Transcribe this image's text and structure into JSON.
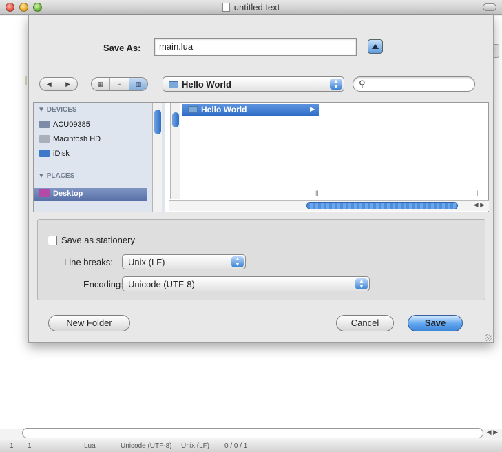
{
  "window": {
    "title": "untitled text"
  },
  "save_sheet": {
    "save_as_label": "Save As:",
    "filename": "main.lua",
    "view_modes": [
      "icon",
      "list",
      "column"
    ],
    "location": "Hello World",
    "search_placeholder": "",
    "sidebar": {
      "devices_header": "DEVICES",
      "devices": [
        "ACU09385",
        "Macintosh HD",
        "iDisk"
      ],
      "places_header": "PLACES",
      "selected_place": "Desktop"
    },
    "browser": {
      "column_items": [
        "Hello World"
      ]
    },
    "options": {
      "stationery_label": "Save as stationery",
      "stationery_checked": false,
      "line_breaks_label": "Line breaks:",
      "line_breaks_value": "Unix (LF)",
      "encoding_label": "Encoding:",
      "encoding_value": "Unicode (UTF-8)"
    },
    "buttons": {
      "new_folder": "New Folder",
      "cancel": "Cancel",
      "save": "Save"
    }
  },
  "statusbar": {
    "line": "1",
    "column": "1",
    "language": "Lua",
    "encoding": "Unicode (UTF-8)",
    "line_endings": "Unix (LF)",
    "counts": "0 / 0 / 1"
  },
  "colors": {
    "accent": "#3f86d8",
    "sidebar_bg": "#dfe5ee",
    "selection": "#2f6dc7"
  }
}
